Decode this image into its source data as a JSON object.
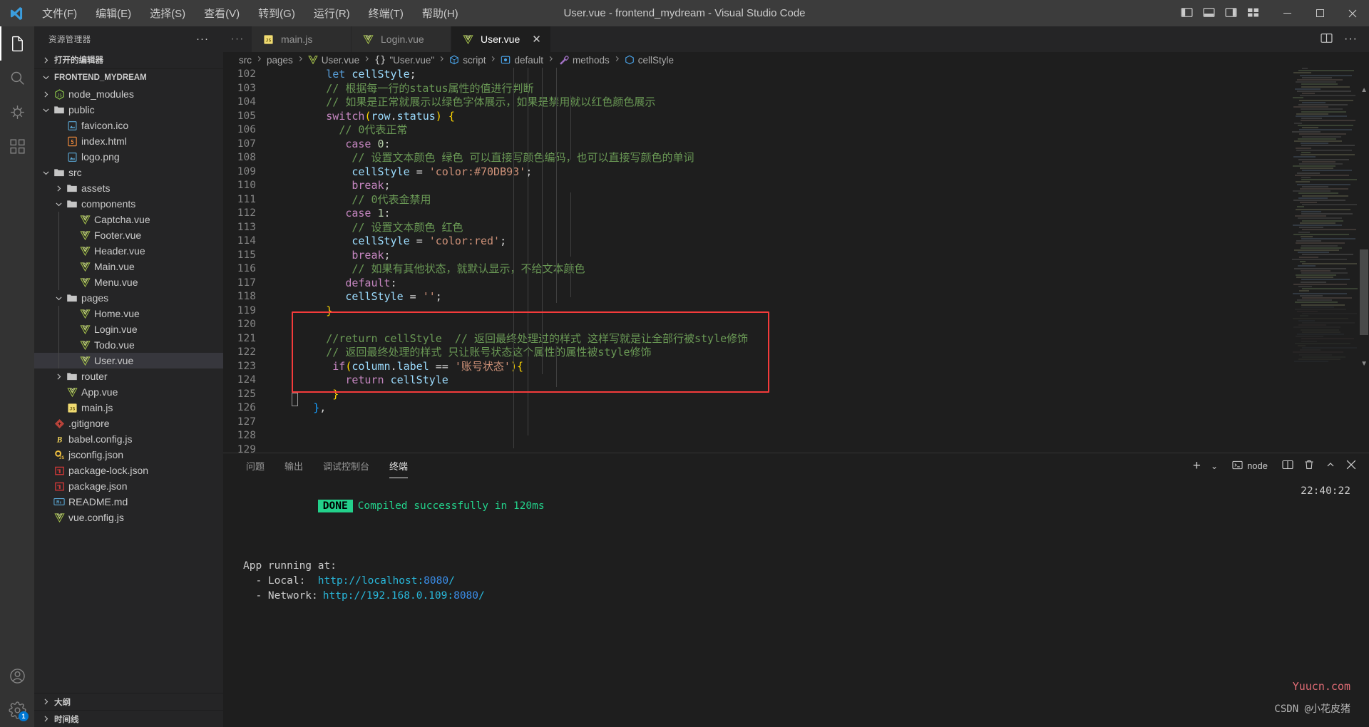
{
  "window": {
    "title": "User.vue - frontend_mydream - Visual Studio Code",
    "menus": [
      "文件(F)",
      "编辑(E)",
      "选择(S)",
      "查看(V)",
      "转到(G)",
      "运行(R)",
      "终端(T)",
      "帮助(H)"
    ],
    "controls": {
      "minimize": "–",
      "maximize": "▢",
      "close": "✕"
    }
  },
  "activitybar": {
    "items": [
      {
        "name": "explorer",
        "icon": "files-icon"
      },
      {
        "name": "search",
        "icon": "search-icon"
      },
      {
        "name": "run-debug",
        "icon": "debug-icon"
      },
      {
        "name": "extensions",
        "icon": "extensions-icon"
      }
    ],
    "bottom": [
      {
        "name": "accounts",
        "icon": "account-icon"
      },
      {
        "name": "settings",
        "icon": "gear-icon",
        "badge": "1"
      }
    ]
  },
  "sidebar": {
    "title": "资源管理器",
    "more_label": "···",
    "open_editors": "打开的编辑器",
    "project": "FRONTEND_MYDREAM",
    "tree": [
      {
        "label": "node_modules",
        "type": "folder",
        "icon": "nodejs-icon",
        "indent": 1,
        "expanded": false
      },
      {
        "label": "public",
        "type": "folder",
        "icon": "folder-icon",
        "indent": 1,
        "expanded": true
      },
      {
        "label": "favicon.ico",
        "type": "file",
        "icon": "image-icon",
        "indent": 2
      },
      {
        "label": "index.html",
        "type": "file",
        "icon": "html-icon",
        "indent": 2
      },
      {
        "label": "logo.png",
        "type": "file",
        "icon": "image-icon",
        "indent": 2
      },
      {
        "label": "src",
        "type": "folder",
        "icon": "folder-icon",
        "indent": 1,
        "expanded": true
      },
      {
        "label": "assets",
        "type": "folder",
        "icon": "folder-icon",
        "indent": 2,
        "expanded": false
      },
      {
        "label": "components",
        "type": "folder",
        "icon": "folder-icon",
        "indent": 2,
        "expanded": true
      },
      {
        "label": "Captcha.vue",
        "type": "file",
        "icon": "vue-icon",
        "indent": 3
      },
      {
        "label": "Footer.vue",
        "type": "file",
        "icon": "vue-icon",
        "indent": 3
      },
      {
        "label": "Header.vue",
        "type": "file",
        "icon": "vue-icon",
        "indent": 3
      },
      {
        "label": "Main.vue",
        "type": "file",
        "icon": "vue-icon",
        "indent": 3
      },
      {
        "label": "Menu.vue",
        "type": "file",
        "icon": "vue-icon",
        "indent": 3
      },
      {
        "label": "pages",
        "type": "folder",
        "icon": "folder-icon",
        "indent": 2,
        "expanded": true
      },
      {
        "label": "Home.vue",
        "type": "file",
        "icon": "vue-icon",
        "indent": 3
      },
      {
        "label": "Login.vue",
        "type": "file",
        "icon": "vue-icon",
        "indent": 3
      },
      {
        "label": "Todo.vue",
        "type": "file",
        "icon": "vue-icon",
        "indent": 3
      },
      {
        "label": "User.vue",
        "type": "file",
        "icon": "vue-icon",
        "indent": 3,
        "selected": true
      },
      {
        "label": "router",
        "type": "folder",
        "icon": "folder-icon",
        "indent": 2,
        "expanded": false
      },
      {
        "label": "App.vue",
        "type": "file",
        "icon": "vue-icon",
        "indent": 2
      },
      {
        "label": "main.js",
        "type": "file",
        "icon": "js-icon",
        "indent": 2
      },
      {
        "label": ".gitignore",
        "type": "file",
        "icon": "git-icon",
        "indent": 1
      },
      {
        "label": "babel.config.js",
        "type": "file",
        "icon": "babel-icon",
        "indent": 1
      },
      {
        "label": "jsconfig.json",
        "type": "file",
        "icon": "jsconfig-icon",
        "indent": 1
      },
      {
        "label": "package-lock.json",
        "type": "file",
        "icon": "npm-icon",
        "indent": 1
      },
      {
        "label": "package.json",
        "type": "file",
        "icon": "npm-icon",
        "indent": 1
      },
      {
        "label": "README.md",
        "type": "file",
        "icon": "markdown-icon",
        "indent": 1
      },
      {
        "label": "vue.config.js",
        "type": "file",
        "icon": "vue-icon",
        "indent": 1
      }
    ],
    "outline": "大纲",
    "timeline": "时间线"
  },
  "editor": {
    "tabs": [
      {
        "label": "main.js",
        "icon": "js-icon",
        "active": false
      },
      {
        "label": "Login.vue",
        "icon": "vue-icon",
        "active": false
      },
      {
        "label": "User.vue",
        "icon": "vue-icon",
        "active": true,
        "close": "✕"
      }
    ],
    "breadcrumb": [
      {
        "label": "src",
        "icon": ""
      },
      {
        "label": "pages",
        "icon": ""
      },
      {
        "label": "User.vue",
        "icon": "vue-icon"
      },
      {
        "label": "\"User.vue\"",
        "icon": "braces-icon"
      },
      {
        "label": "script",
        "icon": "module-icon"
      },
      {
        "label": "default",
        "icon": "object-icon"
      },
      {
        "label": "methods",
        "icon": "method-icon"
      },
      {
        "label": "cellStyle",
        "icon": "field-icon"
      }
    ],
    "first_line": 102,
    "lines": [
      {
        "n": 102,
        "tokens": [
          [
            "",
            "        "
          ],
          [
            "kw2",
            "let"
          ],
          [
            "",
            " "
          ],
          [
            "var",
            "cellStyle"
          ],
          [
            "punc",
            ";"
          ]
        ]
      },
      {
        "n": 103,
        "tokens": [
          [
            "",
            "        "
          ],
          [
            "cmt",
            "// 根据每一行的status属性的值进行判断"
          ]
        ]
      },
      {
        "n": 104,
        "tokens": [
          [
            "",
            "        "
          ],
          [
            "cmt",
            "// 如果是正常就展示以绿色字体展示，如果是禁用就以红色颜色展示"
          ]
        ]
      },
      {
        "n": 105,
        "tokens": [
          [
            "",
            "        "
          ],
          [
            "kw",
            "switch"
          ],
          [
            "br1",
            "("
          ],
          [
            "var",
            "row"
          ],
          [
            "punc",
            "."
          ],
          [
            "var",
            "status"
          ],
          [
            "br1",
            ")"
          ],
          [
            "",
            " "
          ],
          [
            "br1",
            "{"
          ]
        ]
      },
      {
        "n": 106,
        "tokens": [
          [
            "",
            "          "
          ],
          [
            "cmt",
            "// 0代表正常"
          ]
        ]
      },
      {
        "n": 107,
        "tokens": [
          [
            "",
            "           "
          ],
          [
            "kw",
            "case"
          ],
          [
            "",
            " "
          ],
          [
            "num",
            "0"
          ],
          [
            "punc",
            ":"
          ]
        ]
      },
      {
        "n": 108,
        "tokens": [
          [
            "",
            "            "
          ],
          [
            "cmt",
            "// 设置文本颜色 绿色 可以直接写颜色编码，也可以直接写颜色的单词"
          ]
        ]
      },
      {
        "n": 109,
        "tokens": [
          [
            "",
            "            "
          ],
          [
            "var",
            "cellStyle"
          ],
          [
            "",
            " "
          ],
          [
            "punc",
            "="
          ],
          [
            "",
            " "
          ],
          [
            "str",
            "'color:#70DB93'"
          ],
          [
            "punc",
            ";"
          ]
        ]
      },
      {
        "n": 110,
        "tokens": [
          [
            "",
            "            "
          ],
          [
            "kw",
            "break"
          ],
          [
            "punc",
            ";"
          ]
        ]
      },
      {
        "n": 111,
        "tokens": [
          [
            "",
            "            "
          ],
          [
            "cmt",
            "// 0代表金禁用"
          ]
        ]
      },
      {
        "n": 112,
        "tokens": [
          [
            "",
            "           "
          ],
          [
            "kw",
            "case"
          ],
          [
            "",
            " "
          ],
          [
            "num",
            "1"
          ],
          [
            "punc",
            ":"
          ]
        ]
      },
      {
        "n": 113,
        "tokens": [
          [
            "",
            "            "
          ],
          [
            "cmt",
            "// 设置文本颜色 红色"
          ]
        ]
      },
      {
        "n": 114,
        "tokens": [
          [
            "",
            "            "
          ],
          [
            "var",
            "cellStyle"
          ],
          [
            "",
            " "
          ],
          [
            "punc",
            "="
          ],
          [
            "",
            " "
          ],
          [
            "str",
            "'color:red'"
          ],
          [
            "punc",
            ";"
          ]
        ]
      },
      {
        "n": 115,
        "tokens": [
          [
            "",
            "            "
          ],
          [
            "kw",
            "break"
          ],
          [
            "punc",
            ";"
          ]
        ]
      },
      {
        "n": 116,
        "tokens": [
          [
            "",
            "            "
          ],
          [
            "cmt",
            "// 如果有其他状态，就默认显示，不给文本颜色"
          ]
        ]
      },
      {
        "n": 117,
        "tokens": [
          [
            "",
            "           "
          ],
          [
            "kw",
            "default"
          ],
          [
            "punc",
            ":"
          ]
        ]
      },
      {
        "n": 118,
        "tokens": [
          [
            "",
            "           "
          ],
          [
            "var",
            "cellStyle"
          ],
          [
            "",
            " "
          ],
          [
            "punc",
            "="
          ],
          [
            "",
            " "
          ],
          [
            "str",
            "''"
          ],
          [
            "punc",
            ";"
          ]
        ]
      },
      {
        "n": 119,
        "tokens": [
          [
            "",
            "        "
          ],
          [
            "br1",
            "}"
          ]
        ]
      },
      {
        "n": 120,
        "tokens": [
          [
            "",
            ""
          ]
        ]
      },
      {
        "n": 121,
        "tokens": [
          [
            "",
            "        "
          ],
          [
            "cmt",
            "//return cellStyle  // 返回最终处理过的样式 这样写就是让全部行被style修饰"
          ]
        ]
      },
      {
        "n": 122,
        "tokens": [
          [
            "",
            "        "
          ],
          [
            "cmt",
            "// 返回最终处理的样式 只让账号状态这个属性的属性被style修饰"
          ]
        ]
      },
      {
        "n": 123,
        "tokens": [
          [
            "",
            "         "
          ],
          [
            "kw",
            "if"
          ],
          [
            "br1",
            "("
          ],
          [
            "var",
            "column"
          ],
          [
            "punc",
            "."
          ],
          [
            "var",
            "label"
          ],
          [
            "",
            " "
          ],
          [
            "punc",
            "=="
          ],
          [
            "",
            " "
          ],
          [
            "str",
            "'账号状态'"
          ],
          [
            "br1",
            ")"
          ],
          [
            "br1",
            "{"
          ]
        ]
      },
      {
        "n": 124,
        "tokens": [
          [
            "",
            "           "
          ],
          [
            "kw",
            "return"
          ],
          [
            "",
            " "
          ],
          [
            "var",
            "cellStyle"
          ]
        ]
      },
      {
        "n": 125,
        "tokens": [
          [
            "",
            "         "
          ],
          [
            "br1",
            "}"
          ]
        ]
      },
      {
        "n": 126,
        "tokens": [
          [
            "",
            "      "
          ],
          [
            "br3",
            "}"
          ],
          [
            "punc",
            ","
          ]
        ]
      },
      {
        "n": 127,
        "tokens": [
          [
            "",
            ""
          ]
        ]
      },
      {
        "n": 128,
        "tokens": [
          [
            "",
            ""
          ]
        ]
      },
      {
        "n": 129,
        "tokens": [
          [
            "",
            ""
          ]
        ]
      }
    ],
    "annotation": {
      "name": "red-highlight-box",
      "color": "#f43b3b"
    }
  },
  "panel": {
    "tabs": [
      "问题",
      "输出",
      "调试控制台",
      "终端"
    ],
    "active_tab": "终端",
    "actions": {
      "new_terminal": "+",
      "dropdown": "⌄",
      "terminal_name": "node",
      "split": "split-icon",
      "kill": "trash-icon",
      "maximize": "chevron-up-icon",
      "close": "close-icon"
    },
    "terminal": {
      "badge": "DONE",
      "compiled_msg": "Compiled successfully in 120ms",
      "timestamp": "22:40:22",
      "app_running": "App running at:",
      "local_label": "  - Local:  ",
      "local_url_base": "http://localhost:",
      "local_port": "8080",
      "local_tail": "/",
      "network_label": "  - Network:",
      "network_url_base": "http://192.168.0.109:",
      "network_port": "8080",
      "network_tail": "/"
    },
    "watermark1": "Yuucn.com",
    "watermark2": "CSDN @小花皮猪"
  }
}
